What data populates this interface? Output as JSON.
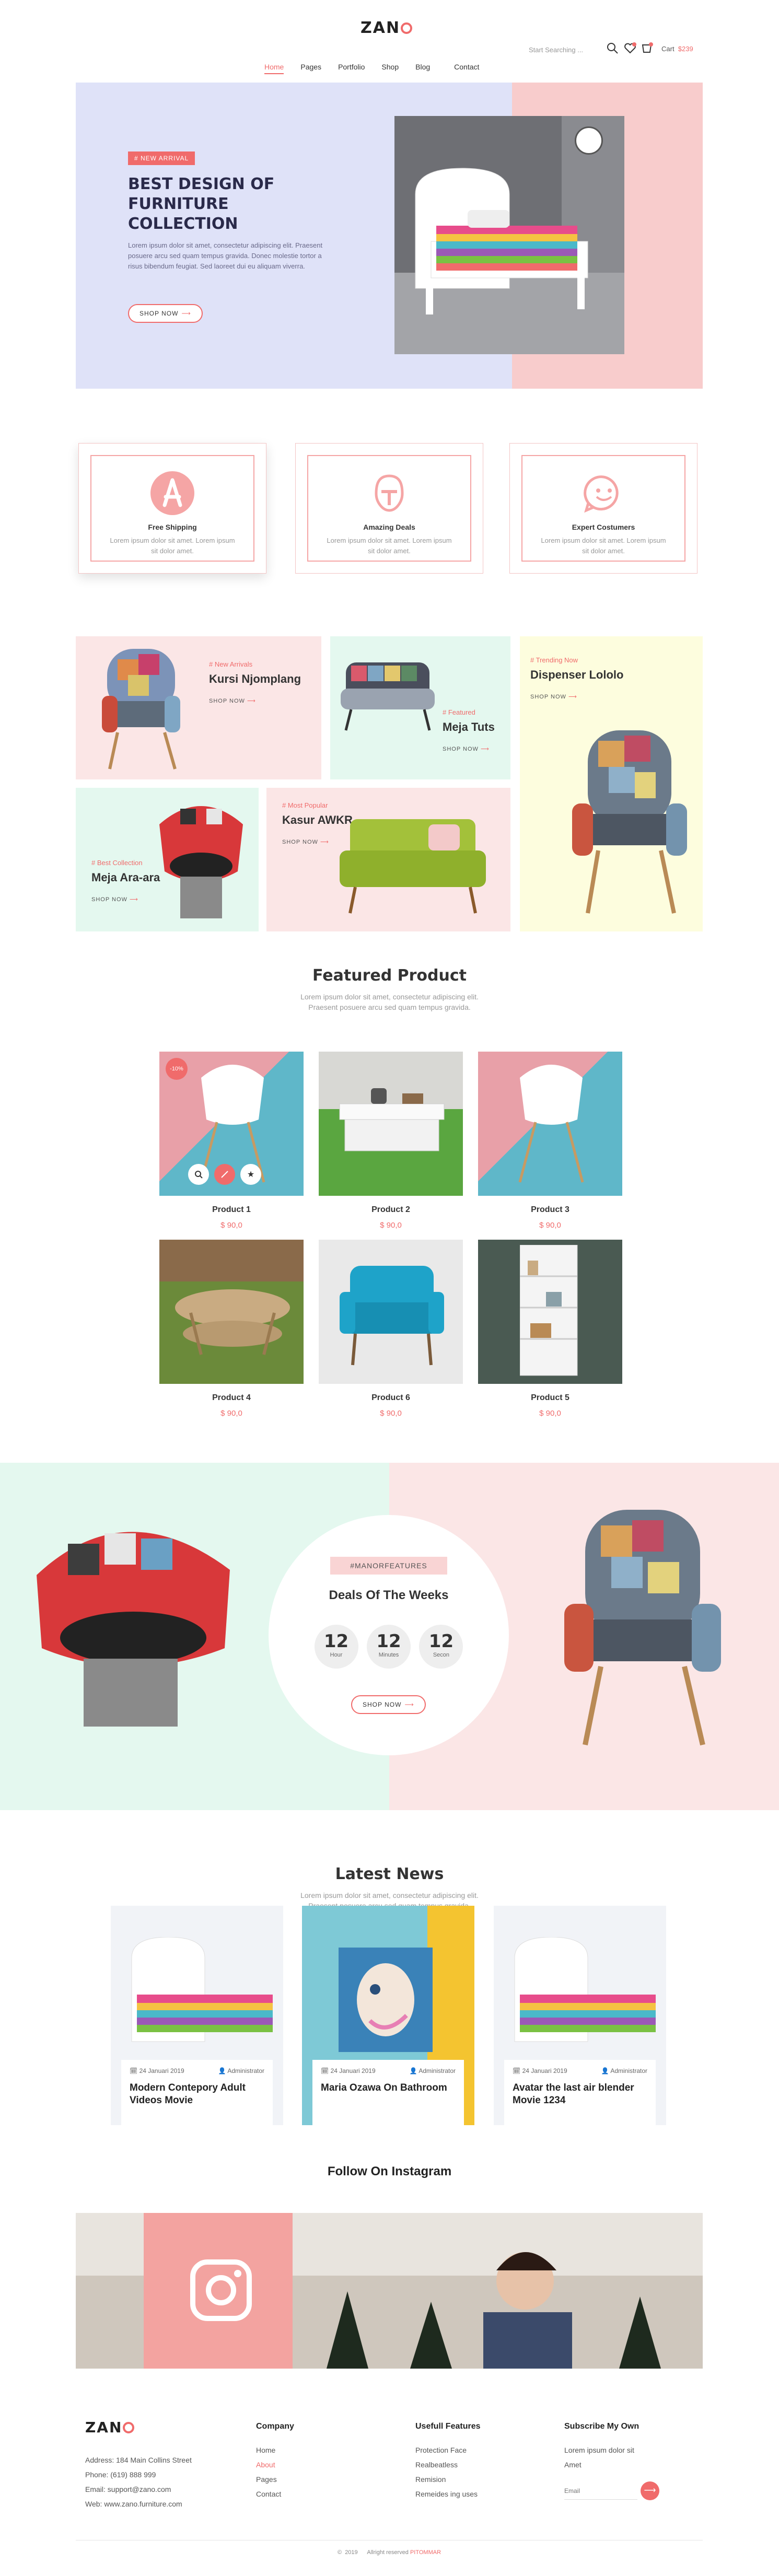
{
  "header": {
    "logo": "ZANO",
    "nav": [
      "Home",
      "Pages",
      "Portfolio",
      "Shop",
      "Blog",
      "Contact"
    ],
    "search_placeholder": "Start Searching ...",
    "cart_label": "Cart",
    "cart_amount": "$239"
  },
  "hero": {
    "tag": "# NEW ARRIVAL",
    "title_line1": "BEST DESIGN OF",
    "title_line2": "FURNITURE COLLECTION",
    "text": "Lorem ipsum dolor sit amet, consectetur adipiscing elit. Praesent posuere arcu sed quam tempus gravida. Donec molestie tortor a risus bibendum feugiat. Sed laoreet dui eu aliquam viverra.",
    "button": "SHOP NOW"
  },
  "services": [
    {
      "title": "Free Shipping",
      "text": "Lorem ipsum dolor sit amet. Lorem ipsum sit dolor amet.",
      "icon": "compass-icon"
    },
    {
      "title": "Amazing Deals",
      "text": "Lorem ipsum dolor sit amet. Lorem ipsum sit dolor amet.",
      "icon": "mandalorian-icon"
    },
    {
      "title": "Expert Costumers",
      "text": "Lorem ipsum dolor sit amet. Lorem ipsum sit dolor amet.",
      "icon": "smile-icon"
    }
  ],
  "categories": [
    {
      "label": "# New Arrivals",
      "name": "Kursi Njomplang",
      "shop": "SHOP NOW"
    },
    {
      "label": "# Featured",
      "name": "Meja Tuts",
      "shop": "SHOP NOW"
    },
    {
      "label": "# Trending Now",
      "name": "Dispenser Lololo",
      "shop": "SHOP NOW"
    },
    {
      "label": "# Best Collection",
      "name": "Meja Ara-ara",
      "shop": "SHOP NOW"
    },
    {
      "label": "# Most Popular",
      "name": "Kasur AWKR",
      "shop": "SHOP NOW"
    }
  ],
  "featured": {
    "title": "Featured Product",
    "sub1": "Lorem ipsum dolor sit amet, consectetur adipiscing elit.",
    "sub2": "Praesent posuere arcu sed quam tempus gravida.",
    "badge": "-10%",
    "products": [
      {
        "name": "Product 1",
        "price": "$ 90,0"
      },
      {
        "name": "Product 2",
        "price": "$ 90,0"
      },
      {
        "name": "Product 3",
        "price": "$ 90,0"
      },
      {
        "name": "Product 4",
        "price": "$ 90,0"
      },
      {
        "name": "Product 6",
        "price": "$ 90,0"
      },
      {
        "name": "Product 5",
        "price": "$ 90,0"
      }
    ]
  },
  "deals": {
    "tag": "#MANORFEATURES",
    "title": "Deals Of The Weeks",
    "timers": [
      {
        "n": "12",
        "u": "Hour"
      },
      {
        "n": "12",
        "u": "Minutes"
      },
      {
        "n": "12",
        "u": "Secon"
      }
    ],
    "button": "SHOP NOW"
  },
  "news": {
    "title": "Latest News",
    "sub1": "Lorem ipsum dolor sit amet, consectetur adipiscing elit.",
    "sub2": "Praesent posuere arcu sed quam tempus gravida.",
    "items": [
      {
        "date": "24 Januari 2019",
        "author": "Administrator",
        "title": "Modern Contepory Adult Videos Movie"
      },
      {
        "date": "24 Januari 2019",
        "author": "Administrator",
        "title": "Maria Ozawa On Bathroom"
      },
      {
        "date": "24 Januari 2019",
        "author": "Administrator",
        "title": "Avatar the last air blender Movie 1234"
      }
    ]
  },
  "instagram": {
    "title": "Follow On Instagram"
  },
  "footer": {
    "logo": "ZANO",
    "address": "Address: 184 Main Collins Street",
    "phone": "Phone: (619) 888 999",
    "email": "Email: support@zano.com",
    "web": "Web: www.zano.furniture.com",
    "company_title": "Company",
    "company_links": [
      "Home",
      "About",
      "Pages",
      "Contact"
    ],
    "useful_title": "Usefull Features",
    "useful_links": [
      "Protection Face",
      "Realbeatless",
      "Remision",
      "Remeides ing uses"
    ],
    "subscribe_title": "Subscribe My Own",
    "subscribe_text1": "Lorem ipsum dolor sit",
    "subscribe_text2": "Amet",
    "subscribe_placeholder": "Email",
    "copyright": "2019",
    "rights": "Allright reserved",
    "brand": "PITOMMAR"
  },
  "colors": {
    "accent": "#f06b6b",
    "hero_left": "#dfe2f8",
    "hero_right": "#f8cccc",
    "mint": "#e4f8ef",
    "pink": "#fbe6e6",
    "cream": "#fdfdde"
  }
}
